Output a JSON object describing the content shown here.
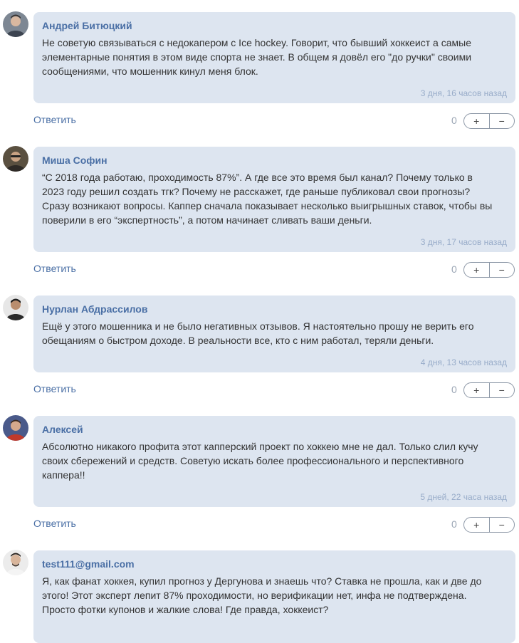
{
  "actions": {
    "reply_label": "Ответить",
    "plus_label": "+",
    "minus_label": "−"
  },
  "comments": [
    {
      "author": "Андрей Битюцкий",
      "text": "Не советую связываться с недокапером с Ice hockey. Говорит, что бывший хоккеист а самые элементарные понятия в этом виде спорта не знает. В общем я довёл его \"до ручки\" своими сообщениями, что мошенник кинул меня блок.",
      "date": "3 дня, 16 часов назад",
      "score": "0"
    },
    {
      "author": "Миша Софин",
      "text": "“С 2018 года работаю, проходимость 87%”. А где все это время был канал? Почему только в 2023 году решил создать тгк? Почему не расскажет, где раньше публиковал свои прогнозы? Сразу возникают вопросы. Каппер сначала показывает несколько выигрышных ставок, чтобы вы поверили в его “экспертность”, а потом начинает сливать ваши деньги.",
      "date": "3 дня, 17 часов назад",
      "score": "0"
    },
    {
      "author": "Нурлан Абдрассилов",
      "text": "Ещё у этого мошенника и не было негативных отзывов. Я настоятельно прошу не верить его обещаниям о быстром доходе. В реальности все, кто с ним работал, теряли деньги.",
      "date": "4 дня, 13 часов назад",
      "score": "0"
    },
    {
      "author": "Алексей",
      "text": "Абсолютно никакого профита этот капперский проект по хоккею мне не дал. Только слил кучу своих сбережений и средств. Советую искать более профессионального и перспективного каппера!!",
      "date": "5 дней, 22 часа назад",
      "score": "0"
    },
    {
      "author": "test111@gmail.com",
      "text": "Я, как фанат хоккея, купил прогноз у Дергунова и знаешь что? Ставка не прошла, как и две до этого! Этот эксперт лепит 87% проходимости, но верификации нет, инфа не подтверждена. Просто фотки купонов и жалкие слова! Где правда, хоккеист?",
      "date": "",
      "score": ""
    }
  ]
}
